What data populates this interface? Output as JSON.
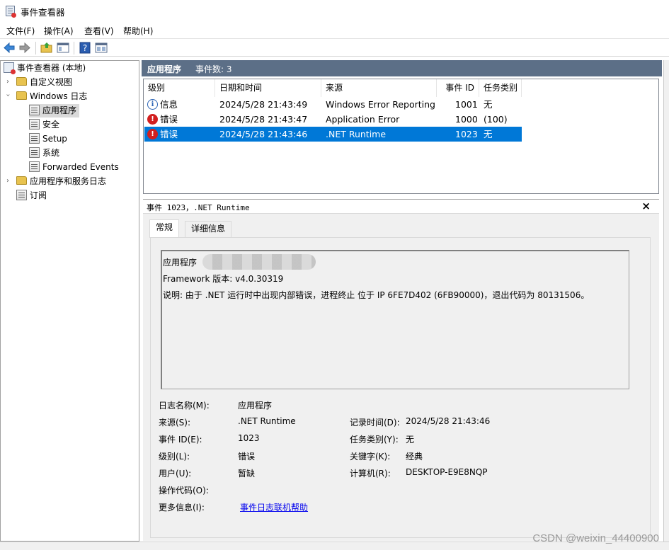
{
  "window": {
    "title": "事件查看器"
  },
  "menu": [
    {
      "label": "文件(F)"
    },
    {
      "label": "操作(A)"
    },
    {
      "label": "查看(V)"
    },
    {
      "label": "帮助(H)"
    }
  ],
  "toolbar": {
    "icons": [
      "back-arrow-icon",
      "forward-arrow-icon",
      "folder-up-icon",
      "show-hide-tree-icon",
      "help-icon",
      "properties-icon"
    ]
  },
  "tree": {
    "root": "事件查看器 (本地)",
    "custom_views": "自定义视图",
    "windows_logs": "Windows 日志",
    "logs": [
      {
        "label": "应用程序",
        "selected": true
      },
      {
        "label": "安全"
      },
      {
        "label": "Setup"
      },
      {
        "label": "系统"
      },
      {
        "label": "Forwarded Events"
      }
    ],
    "app_service_logs": "应用程序和服务日志",
    "subscriptions": "订阅"
  },
  "main": {
    "header_title": "应用程序",
    "header_count": "事件数: 3"
  },
  "events": {
    "columns": [
      "级别",
      "日期和时间",
      "来源",
      "事件 ID",
      "任务类别"
    ],
    "rows": [
      {
        "level": "信息",
        "level_type": "info",
        "datetime": "2024/5/28 21:43:49",
        "source": "Windows Error Reporting",
        "id": "1001",
        "task": "无"
      },
      {
        "level": "错误",
        "level_type": "error",
        "datetime": "2024/5/28 21:43:47",
        "source": "Application Error",
        "id": "1000",
        "task": "(100)"
      },
      {
        "level": "错误",
        "level_type": "error",
        "datetime": "2024/5/28 21:43:46",
        "source": ".NET Runtime",
        "id": "1023",
        "task": "无",
        "selected": true
      }
    ]
  },
  "detail": {
    "title": "事件 1023，.NET Runtime",
    "close": "×",
    "tabs": [
      "常规",
      "详细信息"
    ],
    "description": {
      "line1": "应用程序",
      "line2": "Framework 版本: v4.0.30319",
      "line3": "说明: 由于 .NET 运行时中出现内部错误，进程终止 位于 IP 6FE7D402 (6FB90000)，退出代码为 80131506。"
    },
    "fields": {
      "log_name_label": "日志名称(M):",
      "log_name": "应用程序",
      "source_label": "来源(S):",
      "source": ".NET Runtime",
      "logged_label": "记录时间(D):",
      "logged": "2024/5/28 21:43:46",
      "event_id_label": "事件 ID(E):",
      "event_id": "1023",
      "task_label": "任务类别(Y):",
      "task": "无",
      "level_label": "级别(L):",
      "level": "错误",
      "keywords_label": "关键字(K):",
      "keywords": "经典",
      "user_label": "用户(U):",
      "user": "暂缺",
      "computer_label": "计算机(R):",
      "computer": "DESKTOP-E9E8NQP",
      "opcode_label": "操作代码(O):",
      "more_info_label": "更多信息(I):",
      "more_info_link": "事件日志联机帮助"
    }
  },
  "watermark": "CSDN @weixin_44400900",
  "colors": {
    "header_bg": "#5c6f87",
    "selection": "#0078d7",
    "error_red": "#d21f1f",
    "info_blue": "#2a63b5"
  }
}
